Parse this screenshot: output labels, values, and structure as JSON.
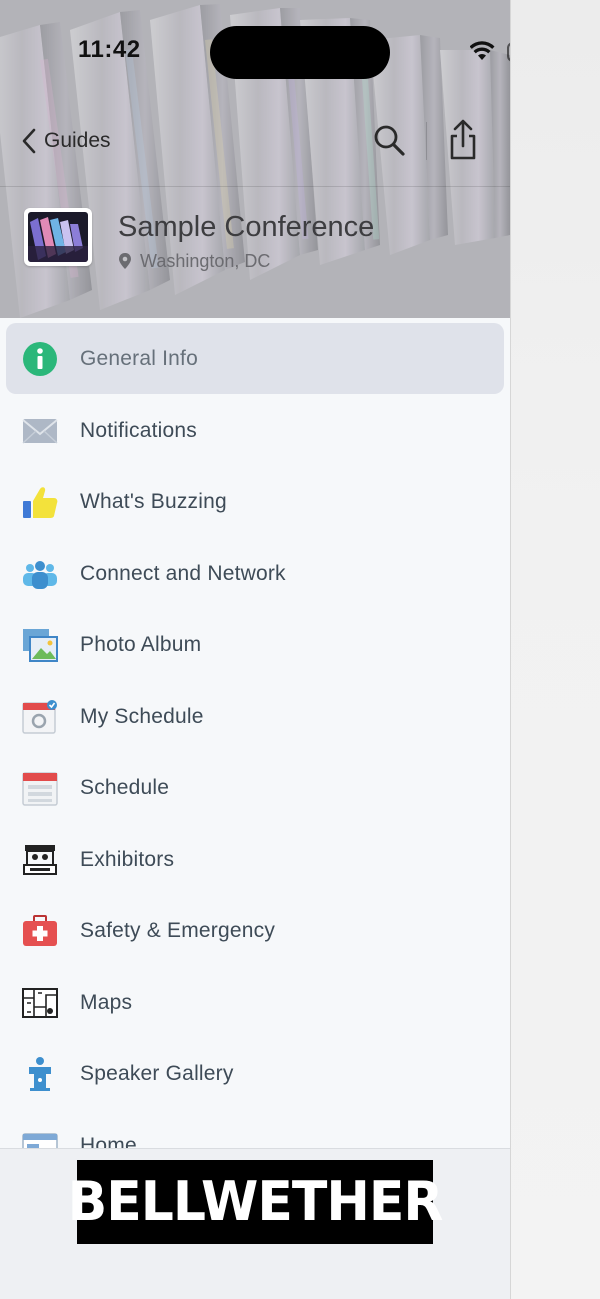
{
  "status_bar": {
    "time": "11:42"
  },
  "nav": {
    "back_label": "Guides"
  },
  "event": {
    "title": "Sample Conference",
    "location": "Washington, DC"
  },
  "menu": {
    "items": [
      {
        "label": "General Info",
        "icon": "info-icon",
        "active": true
      },
      {
        "label": "Notifications",
        "icon": "envelope-icon"
      },
      {
        "label": "What's Buzzing",
        "icon": "thumbs-up-icon"
      },
      {
        "label": "Connect and Network",
        "icon": "people-icon"
      },
      {
        "label": "Photo Album",
        "icon": "photo-icon"
      },
      {
        "label": "My Schedule",
        "icon": "my-schedule-icon"
      },
      {
        "label": "Schedule",
        "icon": "calendar-icon"
      },
      {
        "label": "Exhibitors",
        "icon": "exhibitor-booth-icon"
      },
      {
        "label": "Safety & Emergency",
        "icon": "first-aid-icon"
      },
      {
        "label": "Maps",
        "icon": "map-icon"
      },
      {
        "label": "Speaker Gallery",
        "icon": "podium-icon"
      },
      {
        "label": "Home",
        "icon": "home-icon"
      }
    ]
  },
  "footer": {
    "ad_text": "BELLWETHER"
  },
  "colors": {
    "active_row": "#dfe2ea",
    "drawer_bg": "#f6f8fa",
    "info_green": "#2bb77a",
    "label": "#3e4b57"
  }
}
